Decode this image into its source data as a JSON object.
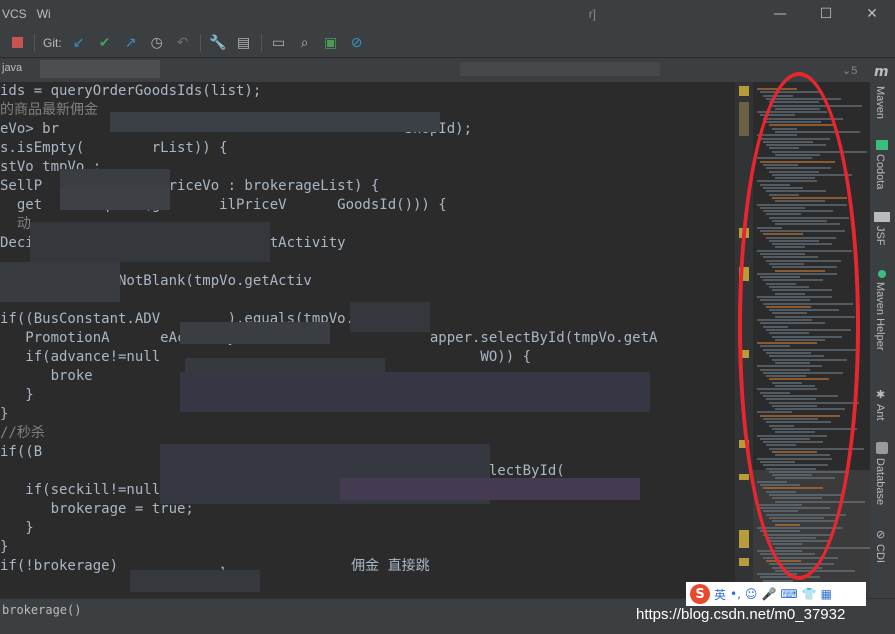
{
  "menu": [
    "VCS",
    "Wi"
  ],
  "title_fragment": "r]",
  "window_controls": {
    "minimize": "—",
    "maximize": "☐",
    "close": "✕"
  },
  "toolbar": {
    "git_label": "Git:"
  },
  "tabs": {
    "left_tab": "java"
  },
  "code_lines": [
    {
      "text": "ids = queryOrderGoodsIds(list);"
    },
    {
      "text": "的商品最新佣金"
    },
    {
      "text": "eVo> br                                         ShopId);"
    },
    {
      "text": "s.isEmpty(        rList)) {"
    },
    {
      "text": "stVo tmpVo :"
    },
    {
      "text": "SellP           eilPriceVo : brokerageList) {"
    },
    {
      "text": "  get      equals(ge      ilPriceV      GoodsId())) {"
    },
    {
      "text": "  动"
    },
    {
      "text": "Decima    ivityP          Dt  getActivity"
    },
    {
      "text": ""
    },
    {
      "text": "StringUtils.isNotBlank(tmpVo.getActiv"
    },
    {
      "text": ""
    },
    {
      "text": "if((BusConstant.ADV        ).equals(tmpVo.get"
    },
    {
      "text": "   PromotionA      eActivity advance               apper.selectById(tmpVo.getA"
    },
    {
      "text": "   if(advance!=null                                      WO)) {"
    },
    {
      "text": "      broke"
    },
    {
      "text": "   }"
    },
    {
      "text": "}"
    },
    {
      "text": "//秒杀"
    },
    {
      "text": "if((B                         0VO            ypeCode())) {"
    },
    {
      "text": "                       seckill                         .selectById("
    },
    {
      "text": "   if(seckill!=null&&seckill.getBrokerage().eq    BusConstant"
    },
    {
      "text": "      brokerage = true;"
    },
    {
      "text": "   }"
    },
    {
      "text": "}"
    },
    {
      "text": "if(!brokerage)            ，              佣金 直接跳"
    }
  ],
  "right_panel": [
    "Maven",
    "Codota",
    "JSF",
    "Maven Helper",
    "Ant",
    "Database",
    "CDI"
  ],
  "status": {
    "left_text": "brokerage()"
  },
  "ime": {
    "label": "英"
  },
  "watermark": "https://blog.csdn.net/m0_37932"
}
